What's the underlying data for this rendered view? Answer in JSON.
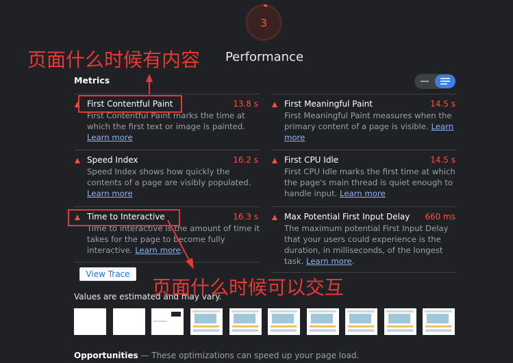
{
  "score": {
    "value": "3",
    "color": "#ff4e42"
  },
  "category_title": "Performance",
  "metrics_title": "Metrics",
  "toggle": {
    "compact_icon": "list-compact-icon",
    "expanded_icon": "list-expanded-icon",
    "selected": "expanded"
  },
  "metrics": [
    {
      "name": "First Contentful Paint",
      "value": "13.8 s",
      "desc": "First Contentful Paint marks the time at which the first text or image is painted.",
      "link": "Learn more",
      "end": ""
    },
    {
      "name": "First Meaningful Paint",
      "value": "14.5 s",
      "desc": "First Meaningful Paint measures when the primary content of a page is visible.",
      "link": "Learn more",
      "end": ""
    },
    {
      "name": "Speed Index",
      "value": "16.2 s",
      "desc": "Speed Index shows how quickly the contents of a page are visibly populated.",
      "link": "Learn more",
      "end": ""
    },
    {
      "name": "First CPU Idle",
      "value": "14.5 s",
      "desc": "First CPU Idle marks the first time at which the page's main thread is quiet enough to handle input.",
      "link": "Learn more",
      "end": ""
    },
    {
      "name": "Time to Interactive",
      "value": "16.3 s",
      "desc": "Time to interactive is the amount of time it takes for the page to become fully interactive.",
      "link": "Learn more",
      "end": "."
    },
    {
      "name": "Max Potential First Input Delay",
      "value": "660 ms",
      "desc": "The maximum potential First Input Delay that your users could experience is the duration, in milliseconds, of the longest task.",
      "link": "Learn more",
      "end": "."
    }
  ],
  "view_trace": "View Trace",
  "estimate_note": "Values are estimated and may vary.",
  "filmstrip": {
    "frame_count": 10
  },
  "opportunities": {
    "title": "Opportunities",
    "text": " — These optimizations can speed up your page load."
  },
  "annotations": {
    "top": "页面什么时候有内容",
    "bottom": "页面什么时候可以交互",
    "color": "#e53935"
  },
  "colors": {
    "background": "#202124",
    "fail": "#ff4e42",
    "link": "#8ab4f8",
    "accent": "#3d7ee6"
  }
}
